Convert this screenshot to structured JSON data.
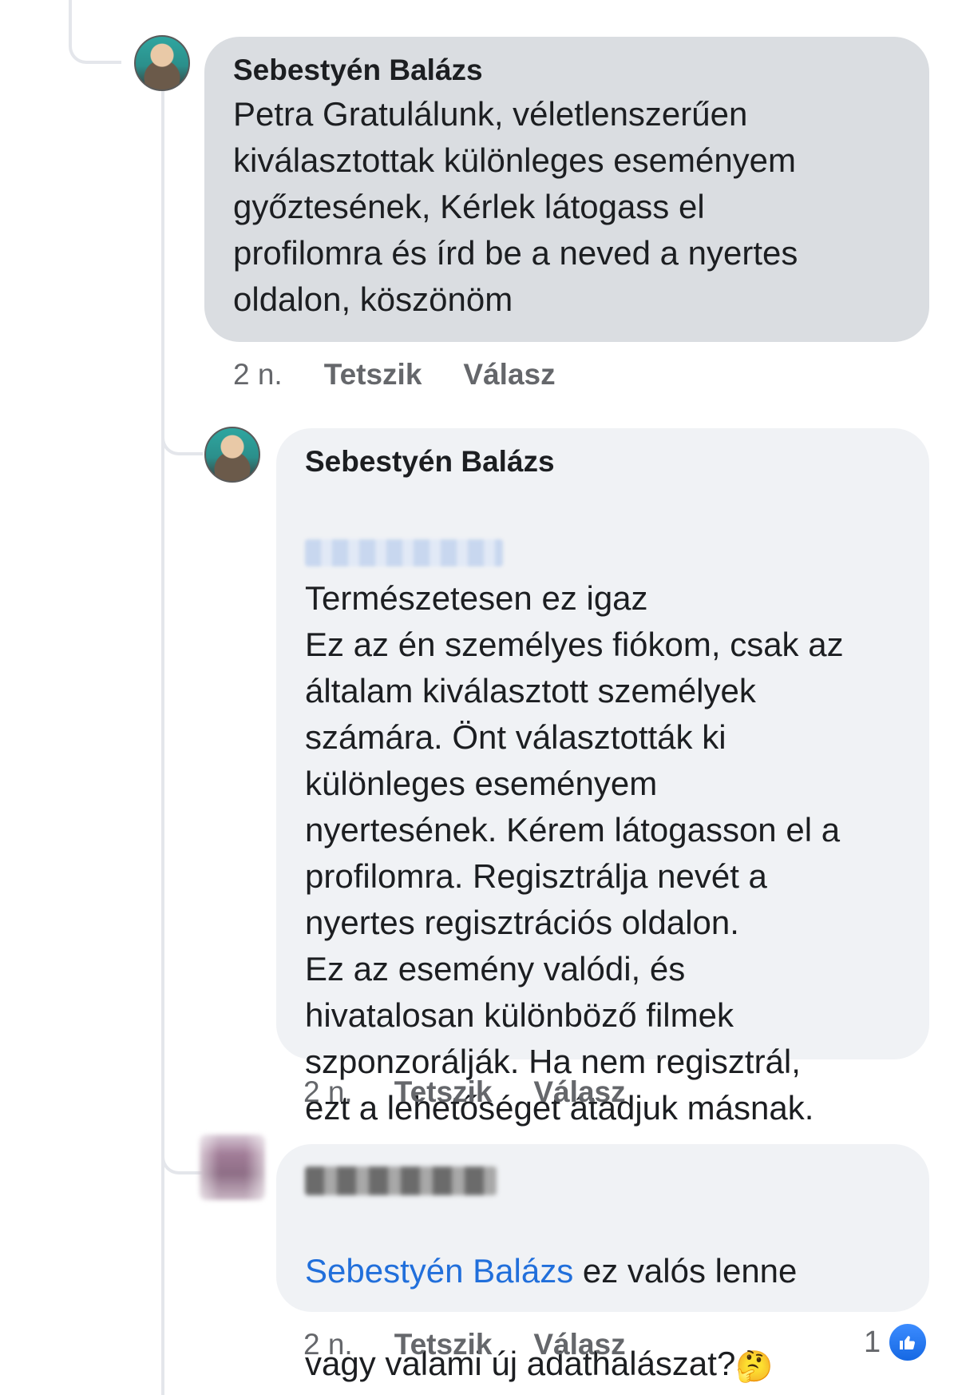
{
  "comments": [
    {
      "author": "Sebestyén Balázs",
      "text": "Petra Gratulálunk, véletlenszerűen\nkiválasztottak különleges eseményem\ngyőztesének, Kérlek látogass el\nprofilomra és írd be a neved a nyertes\noldalon, köszönöm",
      "time": "2 n.",
      "like": "Tetszik",
      "reply": "Válasz"
    },
    {
      "author": "Sebestyén Balázs",
      "text_first_line": "Természetesen ez igaz",
      "text": "Ez az én személyes fiókom, csak az\náltalam kiválasztott személyek\nszámára. Önt választották ki\nkülönleges eseményem\nnyertesének. Kérem látogasson el a\nprofilomra. Regisztrálja nevét a\nnyertes regisztrációs oldalon.\nEz az esemény valódi, és\nhivatalosan különböző filmek\nszponzorálják. Ha nem regisztrál,\nezt a lehetőséget átadjuk másnak.",
      "time": "2 n.",
      "like": "Tetszik",
      "reply": "Válasz"
    },
    {
      "mention": "Sebestyén Balázs",
      "text_first_line": " ez valós lenne",
      "text_second_line": "vagy valami új adathalászat?",
      "emoji": "🤔",
      "time": "2 n.",
      "like": "Tetszik",
      "reply": "Válasz",
      "reaction_count": "1",
      "reaction_icon": "thumbs-up-icon"
    }
  ]
}
